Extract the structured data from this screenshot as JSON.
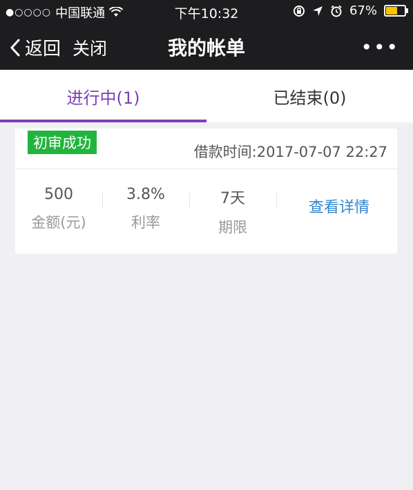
{
  "status_bar": {
    "signal": "●○○○○",
    "carrier": "中国联通",
    "time": "下午10:32",
    "battery_text": "67%",
    "battery_level": 0.67,
    "battery_color": "#ffc400"
  },
  "nav": {
    "back_label": "返回",
    "close_label": "关闭",
    "title": "我的帐单",
    "more_label": "•••"
  },
  "tabs": [
    {
      "label": "进行中(1)",
      "active": true
    },
    {
      "label": "已结束(0)",
      "active": false
    }
  ],
  "bill": {
    "status_badge": "初审成功",
    "loan_time": "借款时间:2017-07-07 22:27",
    "amount_value": "500",
    "amount_label": "金额(元)",
    "rate_value": "3.8%",
    "rate_label": "利率",
    "term_value": "7天",
    "term_label": "期限",
    "details_link": "查看详情"
  },
  "colors": {
    "accent": "#7b3fb7",
    "badge": "#22b53d",
    "link": "#2f86d0"
  }
}
